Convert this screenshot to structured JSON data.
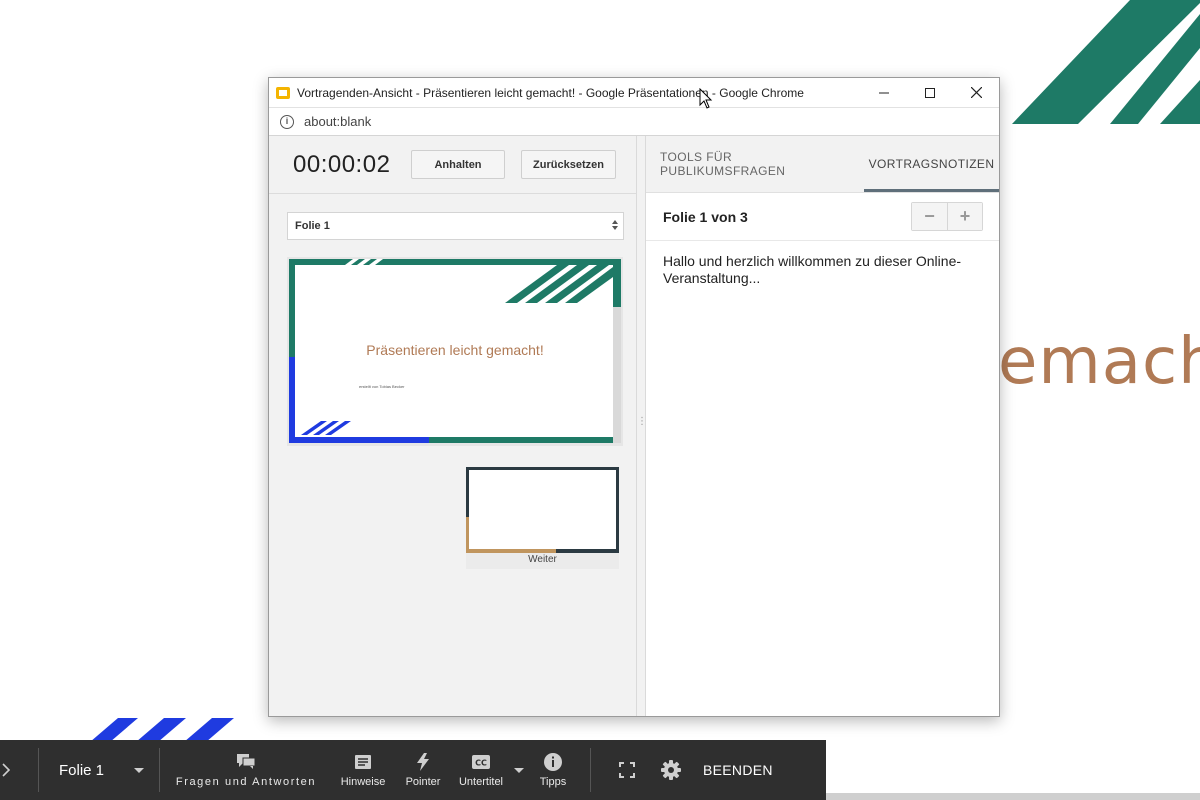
{
  "background_slide": {
    "title_fragment": "emach"
  },
  "toolbar": {
    "slide_select": "Folie 1",
    "qa_label": "Fragen und Antworten",
    "hints_label": "Hinweise",
    "pointer_label": "Pointer",
    "subtitles_label": "Untertitel",
    "tips_label": "Tipps",
    "end_label": "BEENDEN"
  },
  "window": {
    "title": "Vortragenden-Ansicht - Präsentieren leicht gemacht! - Google Präsentationen - Google Chrome",
    "address": "about:blank"
  },
  "presenter": {
    "timer": "00:00:02",
    "pause_label": "Anhalten",
    "reset_label": "Zurücksetzen",
    "slide_dropdown": "Folie 1",
    "current_slide_title": "Präsentieren leicht gemacht!",
    "current_slide_author": "erstellt von Tobias Becker",
    "next_label": "Weiter"
  },
  "notes_panel": {
    "tab_questions": "TOOLS FÜR PUBLIKUMSFRAGEN",
    "tab_notes": "VORTRAGSNOTIZEN",
    "slide_count": "Folie 1 von 3",
    "zoom_out": "−",
    "zoom_in": "+",
    "notes": "Hallo und herzlich willkommen zu dieser Online-Veranstaltung..."
  },
  "colors": {
    "accent_green": "#1e7a66",
    "accent_blue": "#1f3be0",
    "title_brown": "#b07a55",
    "toolbar_bg": "#2f2f2f"
  }
}
